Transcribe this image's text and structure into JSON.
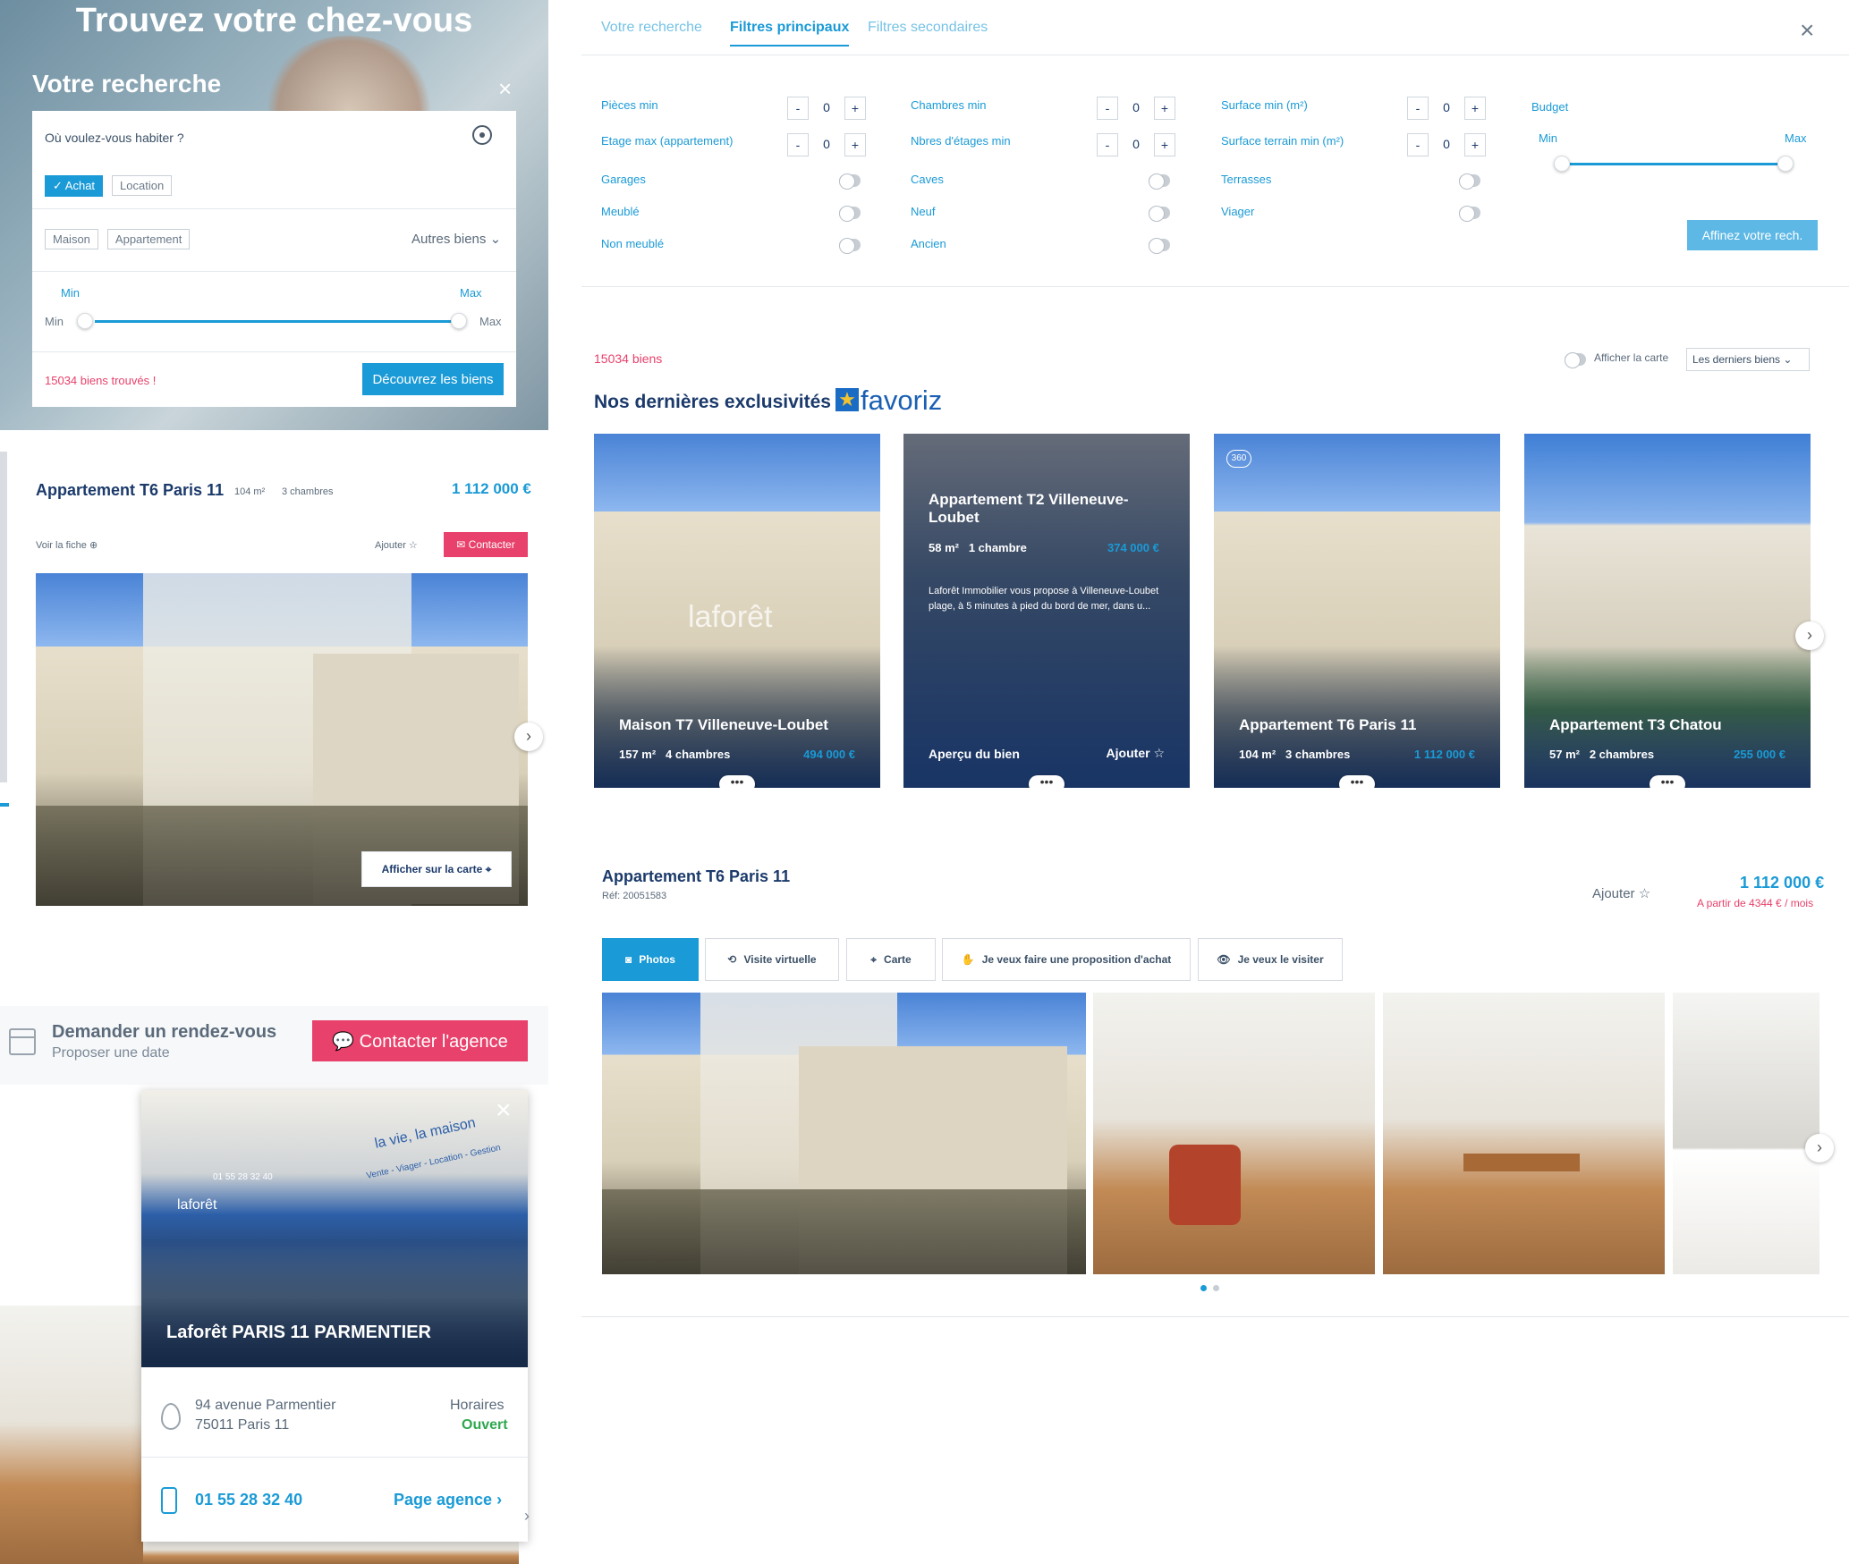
{
  "hero": {
    "title": "Trouvez votre chez-vous",
    "search_title": "Votre recherche",
    "close": "×",
    "where_label": "Où voulez-vous habiter ?",
    "tx_tabs": [
      "Achat",
      "Location"
    ],
    "types": [
      "Maison",
      "Appartement"
    ],
    "other_types": "Autres biens",
    "budget_min_label": "Min",
    "budget_max_label": "Max",
    "min_side": "Min",
    "max_side": "Max",
    "found": "15034 biens trouvés !",
    "discover": "Découvrez les biens"
  },
  "left_card": {
    "title": "Appartement T6 Paris 11",
    "area": "104 m²",
    "rooms": "3 chambres",
    "price": "1 112 000 €",
    "view": "Voir la fiche",
    "add": "Ajouter",
    "contact": "Contacter",
    "map_btn": "Afficher sur la carte"
  },
  "appointment": {
    "title": "Demander un rendez-vous",
    "sub": "Proposer une date",
    "contact_agency": "Contacter l'agence"
  },
  "agency": {
    "photo_text_1": "la vie, la maison",
    "photo_text_2": "Vente - Viager - Location - Gestion",
    "photo_phone": "01 55 28 32 40",
    "photo_brand": "laforêt",
    "name": "Laforêt PARIS 11 PARMENTIER",
    "address_1": "94 avenue Parmentier",
    "address_2": "75011  Paris 11",
    "hours_label": "Horaires",
    "hours_status": "Ouvert",
    "phone": "01 55 28 32 40",
    "page_link": "Page agence"
  },
  "filters": {
    "tabs": [
      "Votre recherche",
      "Filtres principaux",
      "Filtres secondaires"
    ],
    "active_tab": "Filtres principaux",
    "col1": [
      "Pièces min",
      "Etage max (appartement)",
      "Garages",
      "Meublé",
      "Non meublé"
    ],
    "col2": [
      "Chambres min",
      "Nbres d'étages min",
      "Caves",
      "Neuf",
      "Ancien"
    ],
    "col3": [
      "Surface min (m²)",
      "Surface terrain min (m²)",
      "Terrasses",
      "Viager"
    ],
    "stepper_value": "0",
    "minus": "-",
    "plus": "+",
    "budget": "Budget",
    "budget_min": "Min",
    "budget_max": "Max",
    "refine": "Affinez votre rech."
  },
  "results": {
    "count": "15034 biens",
    "map_toggle": "Afficher la carte",
    "sort": "Les derniers biens",
    "section_title": "Nos dernières exclusivités",
    "brand": "favoriz"
  },
  "exclusives": [
    {
      "title": "Maison T7 Villeneuve-Loubet",
      "area": "157 m²",
      "rooms": "4 chambres",
      "price": "494 000 €",
      "watermark": "laforêt"
    },
    {
      "title": "Appartement T2 Villeneuve-Loubet",
      "area": "58 m²",
      "rooms": "1 chambre",
      "price": "374 000 €",
      "desc": "Laforêt Immobilier vous propose à Villeneuve-Loubet plage, à 5 minutes à pied du bord de mer, dans u...",
      "preview": "Aperçu du bien",
      "add": "Ajouter"
    },
    {
      "title": "Appartement T6 Paris 11",
      "area": "104 m²",
      "rooms": "3 chambres",
      "price": "1 112 000 €",
      "badge": "360"
    },
    {
      "title": "Appartement T3 Chatou",
      "area": "57 m²",
      "rooms": "2 chambres",
      "price": "255 000 €"
    }
  ],
  "detail": {
    "title": "Appartement T6 Paris 11",
    "ref": "Réf: 20051583",
    "add": "Ajouter",
    "price": "1 112 000 €",
    "monthly": "A partir de 4344 € / mois",
    "tabs": [
      "Photos",
      "Visite virtuelle",
      "Carte",
      "Je veux faire une proposition d'achat",
      "Je veux le visiter"
    ]
  }
}
